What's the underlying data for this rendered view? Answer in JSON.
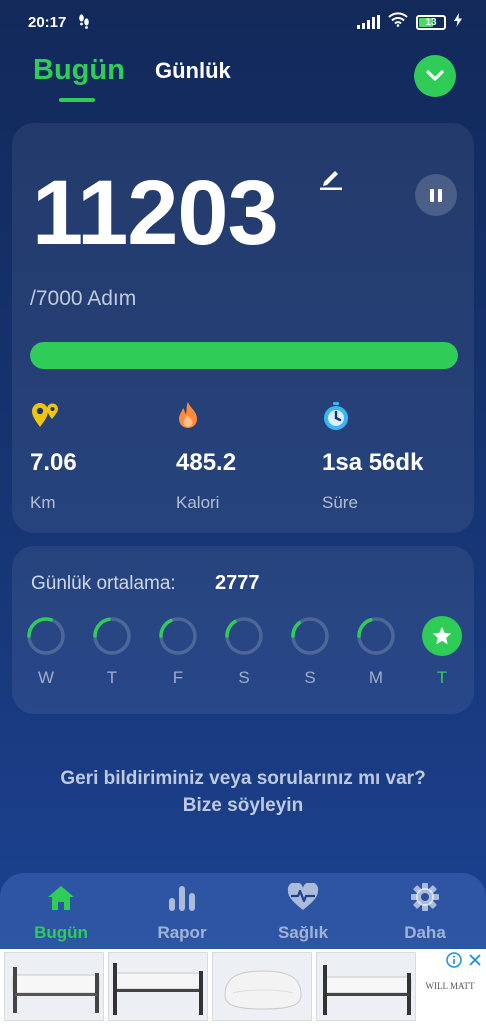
{
  "status_bar": {
    "time": "20:17",
    "battery": "13"
  },
  "tabs": {
    "today": "Bugün",
    "daily": "Günlük"
  },
  "steps": {
    "count": "11203",
    "goal_text": "/7000 Adım",
    "progress_fraction": 1.0
  },
  "stats": [
    {
      "icon": "location-pins-icon",
      "value": "7.06",
      "unit": "Km",
      "color": "#f2c40f"
    },
    {
      "icon": "flame-icon",
      "value": "485.2",
      "unit": "Kalori",
      "color": "#ff8a3d"
    },
    {
      "icon": "stopwatch-icon",
      "value": "1sa 56dk",
      "unit": "Süre",
      "color": "#39b6f5"
    }
  ],
  "weekly": {
    "avg_label": "Günlük ortalama:",
    "avg_value": "2777",
    "days": [
      {
        "label": "W",
        "fraction": 0.3,
        "today": false
      },
      {
        "label": "T",
        "fraction": 0.22,
        "today": false
      },
      {
        "label": "F",
        "fraction": 0.18,
        "today": false
      },
      {
        "label": "S",
        "fraction": 0.16,
        "today": false
      },
      {
        "label": "S",
        "fraction": 0.14,
        "today": false
      },
      {
        "label": "M",
        "fraction": 0.2,
        "today": false
      },
      {
        "label": "T",
        "fraction": 1.0,
        "today": true
      }
    ]
  },
  "feedback": {
    "line1": "Geri bildiriminiz veya sorularınız mı var?",
    "line2": "Bize söyleyin"
  },
  "bottom_nav": [
    {
      "icon": "home-icon",
      "label": "Bugün",
      "active": true
    },
    {
      "icon": "bar-chart-icon",
      "label": "Rapor",
      "active": false
    },
    {
      "icon": "heart-pulse-icon",
      "label": "Sağlık",
      "active": false
    },
    {
      "icon": "gear-icon",
      "label": "Daha",
      "active": false
    }
  ],
  "ad": {
    "logo_text": "WILL MATT"
  },
  "colors": {
    "accent": "#2fcc58",
    "background_top": "#12295a",
    "background_bottom": "#1c4496"
  }
}
